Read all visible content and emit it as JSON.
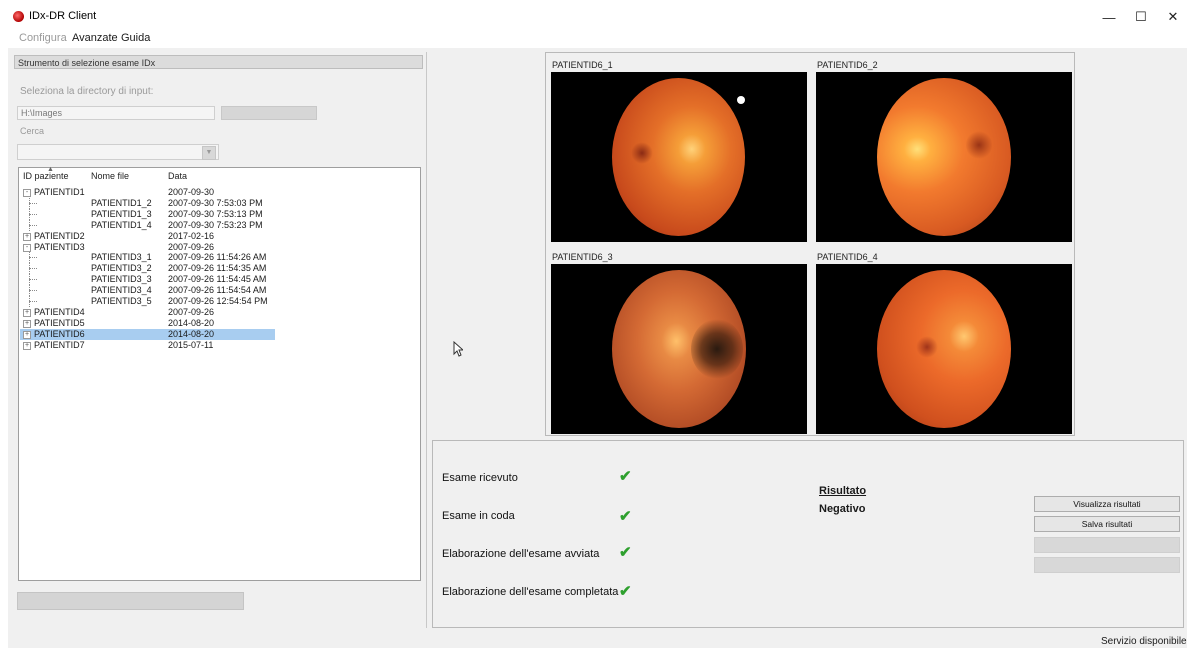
{
  "window": {
    "title": "IDx-DR Client"
  },
  "menu": [
    "Configura",
    "Avanzate",
    "Guida"
  ],
  "tool_header": "Strumento di selezione esame IDx",
  "input_dir": {
    "label": "Seleziona la directory di input:",
    "value": "H:\\Images",
    "search_label": "Cerca"
  },
  "tree": {
    "columns": [
      "ID paziente",
      "Nome file",
      "Data"
    ],
    "rows": [
      {
        "id": "PATIENTID1",
        "file": "",
        "date": "2007-09-30",
        "level": 0,
        "expander": "-"
      },
      {
        "id": "",
        "file": "PATIENTID1_2",
        "date": "2007-09-30 7:53:03 PM",
        "level": 1
      },
      {
        "id": "",
        "file": "PATIENTID1_3",
        "date": "2007-09-30 7:53:13 PM",
        "level": 1
      },
      {
        "id": "",
        "file": "PATIENTID1_4",
        "date": "2007-09-30 7:53:23 PM",
        "level": 1
      },
      {
        "id": "PATIENTID2",
        "file": "",
        "date": "2017-02-16",
        "level": 0,
        "expander": "+"
      },
      {
        "id": "PATIENTID3",
        "file": "",
        "date": "2007-09-26",
        "level": 0,
        "expander": "-"
      },
      {
        "id": "",
        "file": "PATIENTID3_1",
        "date": "2007-09-26 11:54:26 AM",
        "level": 1
      },
      {
        "id": "",
        "file": "PATIENTID3_2",
        "date": "2007-09-26 11:54:35 AM",
        "level": 1
      },
      {
        "id": "",
        "file": "PATIENTID3_3",
        "date": "2007-09-26 11:54:45 AM",
        "level": 1
      },
      {
        "id": "",
        "file": "PATIENTID3_4",
        "date": "2007-09-26 11:54:54 AM",
        "level": 1
      },
      {
        "id": "",
        "file": "PATIENTID3_5",
        "date": "2007-09-26 12:54:54 PM",
        "level": 1
      },
      {
        "id": "PATIENTID4",
        "file": "",
        "date": "2007-09-26",
        "level": 0,
        "expander": "+"
      },
      {
        "id": "PATIENTID5",
        "file": "",
        "date": "2014-08-20",
        "level": 0,
        "expander": "+"
      },
      {
        "id": "PATIENTID6",
        "file": "",
        "date": "2014-08-20",
        "level": 0,
        "expander": "+",
        "selected": true
      },
      {
        "id": "PATIENTID7",
        "file": "",
        "date": "2015-07-11",
        "level": 0,
        "expander": "+"
      }
    ]
  },
  "images": [
    {
      "label": "PATIENTID6_1"
    },
    {
      "label": "PATIENTID6_2"
    },
    {
      "label": "PATIENTID6_3"
    },
    {
      "label": "PATIENTID6_4"
    }
  ],
  "status": {
    "steps": [
      {
        "label": "Esame ricevuto",
        "done": true
      },
      {
        "label": "Esame in coda",
        "done": true
      },
      {
        "label": "Elaborazione dell'esame avviata",
        "done": true
      },
      {
        "label": "Elaborazione dell'esame completata",
        "done": true
      }
    ],
    "result_title": "Risultato",
    "result_value": "Negativo"
  },
  "actions": {
    "view": "Visualizza risultati",
    "save": "Salva risultati"
  },
  "statusbar": "Servizio disponibile",
  "colors": {
    "check": "#2ea02e",
    "selection": "#a8cdf0"
  }
}
